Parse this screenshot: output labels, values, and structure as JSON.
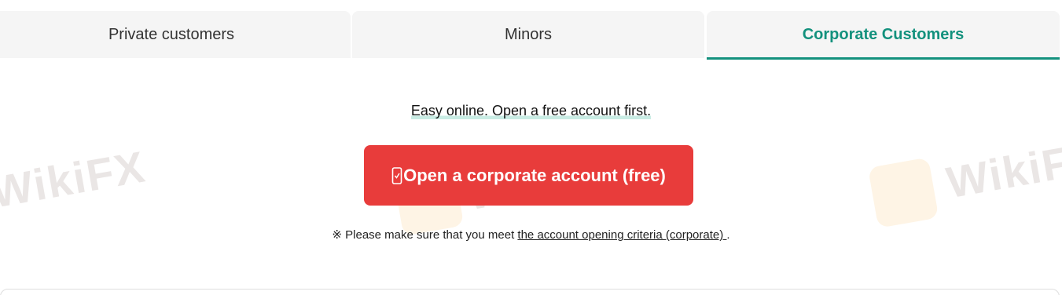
{
  "tabs": [
    {
      "label": "Private customers",
      "active": false
    },
    {
      "label": "Minors",
      "active": false
    },
    {
      "label": "Corporate Customers",
      "active": true
    }
  ],
  "colors": {
    "accent": "#13917d",
    "cta": "#e83c3b",
    "tab_bg": "#f5f5f5"
  },
  "main": {
    "headline": "Easy online. Open a free account first.",
    "cta_label": "Open a corporate account (free)",
    "cta_icon": "smartphone-icon",
    "note_prefix": "※ Please make sure that you meet ",
    "note_link": "the account opening criteria (corporate) ",
    "note_suffix": "."
  },
  "watermark": {
    "text": "WikiFX"
  }
}
